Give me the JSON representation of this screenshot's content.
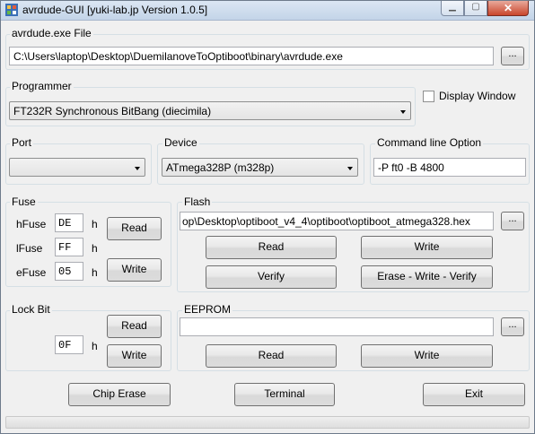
{
  "window": {
    "title": "avrdude-GUI [yuki-lab.jp Version 1.0.5]",
    "minimize_glyph": "▁",
    "maximize_glyph": "▢",
    "close_glyph": "✕"
  },
  "avrdude_file": {
    "group_label": "avrdude.exe File",
    "path": "C:\\Users\\laptop\\Desktop\\DuemilanoveToOptiboot\\binary\\avrdude.exe",
    "browse_label": "..."
  },
  "programmer": {
    "group_label": "Programmer",
    "selected": "FT232R Synchronous BitBang (diecimila)",
    "display_window_label": "Display Window",
    "display_window_checked": false
  },
  "port": {
    "group_label": "Port",
    "selected": ""
  },
  "device": {
    "group_label": "Device",
    "selected": "ATmega328P (m328p)"
  },
  "command_line": {
    "group_label": "Command line Option",
    "value": "-P ft0 -B 4800"
  },
  "fuse": {
    "group_label": "Fuse",
    "hfuse_label": "hFuse",
    "hfuse_value": "DE",
    "lfuse_label": "lFuse",
    "lfuse_value": "FF",
    "efuse_label": "eFuse",
    "efuse_value": "05",
    "hex_suffix": "h",
    "read_label": "Read",
    "write_label": "Write"
  },
  "flash": {
    "group_label": "Flash",
    "path": "op\\Desktop\\optiboot_v4_4\\optiboot\\optiboot_atmega328.hex",
    "browse_label": "...",
    "read_label": "Read",
    "write_label": "Write",
    "verify_label": "Verify",
    "erase_write_verify_label": "Erase - Write - Verify"
  },
  "lock_bit": {
    "group_label": "Lock Bit",
    "value": "0F",
    "hex_suffix": "h",
    "read_label": "Read",
    "write_label": "Write"
  },
  "eeprom": {
    "group_label": "EEPROM",
    "path": "",
    "browse_label": "...",
    "read_label": "Read",
    "write_label": "Write"
  },
  "footer": {
    "chip_erase_label": "Chip Erase",
    "terminal_label": "Terminal",
    "exit_label": "Exit"
  },
  "status": {
    "progress": 0
  }
}
